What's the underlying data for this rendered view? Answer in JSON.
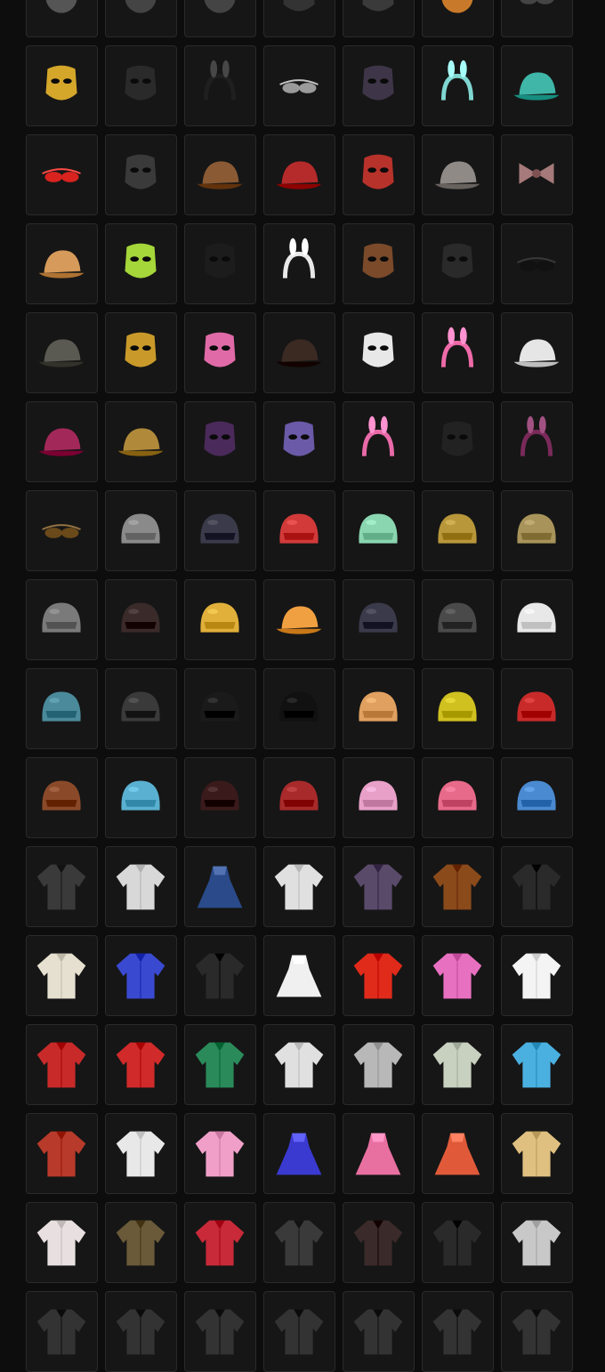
{
  "inventory": {
    "items": [
      {
        "icon": "headwear-icon",
        "color": "#555555"
      },
      {
        "icon": "headwear-icon",
        "color": "#444444"
      },
      {
        "icon": "headwear-icon",
        "color": "#444444"
      },
      {
        "icon": "mask-icon",
        "color": "#333333"
      },
      {
        "icon": "mask-icon",
        "color": "#3a3a3a"
      },
      {
        "icon": "headwear-icon",
        "color": "#c87a2a"
      },
      {
        "icon": "glasses-icon",
        "color": "#444444"
      },
      {
        "icon": "masquerade-mask-icon",
        "color": "#d4a62a"
      },
      {
        "icon": "mask-icon",
        "color": "#2a2a2a"
      },
      {
        "icon": "panda-headband-icon",
        "color": "#1f1f1f"
      },
      {
        "icon": "sunglasses-icon",
        "color": "#9a9a9a"
      },
      {
        "icon": "bandana-mask-icon",
        "color": "#3e3648"
      },
      {
        "icon": "bunny-headband-icon",
        "color": "#7fd6d0"
      },
      {
        "icon": "owl-hat-icon",
        "color": "#3fb6a8"
      },
      {
        "icon": "sunglasses-icon",
        "color": "#d8231f"
      },
      {
        "icon": "skull-mask-icon",
        "color": "#3a3a3a"
      },
      {
        "icon": "aviator-hat-icon",
        "color": "#8a5a34"
      },
      {
        "icon": "cap-icon",
        "color": "#b52a2a"
      },
      {
        "icon": "monster-mask-icon",
        "color": "#b7322b"
      },
      {
        "icon": "beanie-icon",
        "color": "#8f8a86"
      },
      {
        "icon": "bow-icon",
        "color": "#a67a7a"
      },
      {
        "icon": "ice-cream-hat-icon",
        "color": "#d69a5a"
      },
      {
        "icon": "ski-mask-icon",
        "color": "#a5d63a"
      },
      {
        "icon": "face-mask-icon",
        "color": "#1c1c1c"
      },
      {
        "icon": "headband-icon",
        "color": "#e8e8e8"
      },
      {
        "icon": "reindeer-mask-icon",
        "color": "#7a4a2a"
      },
      {
        "icon": "tactical-mask-icon",
        "color": "#2a2a2a"
      },
      {
        "icon": "sunglasses-icon",
        "color": "#111111"
      },
      {
        "icon": "cap-icon",
        "color": "#5a5a52"
      },
      {
        "icon": "dino-mask-icon",
        "color": "#c99a2a"
      },
      {
        "icon": "hippo-mask-icon",
        "color": "#e06aa8"
      },
      {
        "icon": "cowboy-hat-icon",
        "color": "#3a2a22"
      },
      {
        "icon": "face-mask-icon",
        "color": "#e8e8e8"
      },
      {
        "icon": "bow-headband-icon",
        "color": "#ee6aa8"
      },
      {
        "icon": "bear-beanie-icon",
        "color": "#e6e6e6"
      },
      {
        "icon": "beanie-icon",
        "color": "#a3285a"
      },
      {
        "icon": "bucket-hat-icon",
        "color": "#b08a3a"
      },
      {
        "icon": "mask-icon",
        "color": "#4a2a5a"
      },
      {
        "icon": "bunny-mask-icon",
        "color": "#6a5aa8"
      },
      {
        "icon": "bunny-headband-icon",
        "color": "#e86aa8"
      },
      {
        "icon": "eye-mask-icon",
        "color": "#222222"
      },
      {
        "icon": "headband-icon",
        "color": "#7a2a5a"
      },
      {
        "icon": "sunglasses-icon",
        "color": "#6a4a1a"
      },
      {
        "icon": "helmet-icon",
        "color": "#8a8a8a"
      },
      {
        "icon": "helmet-icon",
        "color": "#3a3a4a"
      },
      {
        "icon": "moto-helmet-icon",
        "color": "#d23a3a"
      },
      {
        "icon": "helmet-icon",
        "color": "#8ad6b0"
      },
      {
        "icon": "helmet-icon",
        "color": "#b8963a"
      },
      {
        "icon": "helmet-icon",
        "color": "#a8945a"
      },
      {
        "icon": "helmet-icon",
        "color": "#7a7a7a"
      },
      {
        "icon": "helmet-icon",
        "color": "#3a2a2a"
      },
      {
        "icon": "helmet-icon",
        "color": "#e0b03a"
      },
      {
        "icon": "cap-icon",
        "color": "#f0a040"
      },
      {
        "icon": "helmet-icon",
        "color": "#3a3a4a"
      },
      {
        "icon": "helmet-icon",
        "color": "#4a4a4a"
      },
      {
        "icon": "helmet-icon",
        "color": "#e8e8e8"
      },
      {
        "icon": "helmet-icon",
        "color": "#4a8a9a"
      },
      {
        "icon": "helmet-icon",
        "color": "#3a3a3a"
      },
      {
        "icon": "astronaut-helmet-icon",
        "color": "#1a1a1a"
      },
      {
        "icon": "moto-helmet-icon",
        "color": "#111111"
      },
      {
        "icon": "helmet-icon",
        "color": "#e0a060"
      },
      {
        "icon": "moto-helmet-icon",
        "color": "#d0c020"
      },
      {
        "icon": "helmet-icon",
        "color": "#c82a2a"
      },
      {
        "icon": "diving-helmet-icon",
        "color": "#8a4a2a"
      },
      {
        "icon": "helmet-icon",
        "color": "#5ab0d0"
      },
      {
        "icon": "helmet-icon",
        "color": "#3a1a1a"
      },
      {
        "icon": "helmet-icon",
        "color": "#a82a2a"
      },
      {
        "icon": "helmet-icon",
        "color": "#e8a0c8"
      },
      {
        "icon": "bunny-helmet-icon",
        "color": "#e86a8a"
      },
      {
        "icon": "helmet-icon",
        "color": "#4a8ad0"
      },
      {
        "icon": "shirt-icon",
        "color": "#3a3a3a"
      },
      {
        "icon": "jacket-icon",
        "color": "#d8d8d8"
      },
      {
        "icon": "dress-icon",
        "color": "#2a4a8a"
      },
      {
        "icon": "jacket-icon",
        "color": "#e0e0e0"
      },
      {
        "icon": "jacket-icon",
        "color": "#5a4a6a"
      },
      {
        "icon": "jacket-icon",
        "color": "#8a4a1a"
      },
      {
        "icon": "shirt-icon",
        "color": "#2a2a2a"
      },
      {
        "icon": "hoodie-icon",
        "color": "#e6e0d0"
      },
      {
        "icon": "jacket-icon",
        "color": "#3a4ad0"
      },
      {
        "icon": "jacket-icon",
        "color": "#2a2a2a"
      },
      {
        "icon": "dress-icon",
        "color": "#f0f0f0"
      },
      {
        "icon": "jacket-icon",
        "color": "#e02a1a"
      },
      {
        "icon": "top-icon",
        "color": "#e870c0"
      },
      {
        "icon": "shirt-icon",
        "color": "#f4f4f4"
      },
      {
        "icon": "shirt-icon",
        "color": "#c82a2a"
      },
      {
        "icon": "jacket-icon",
        "color": "#d02a2a"
      },
      {
        "icon": "coat-icon",
        "color": "#2a8a5a"
      },
      {
        "icon": "shirt-icon",
        "color": "#e0e0e0"
      },
      {
        "icon": "shirt-icon",
        "color": "#b8b8b8"
      },
      {
        "icon": "hoodie-icon",
        "color": "#c8d0c0"
      },
      {
        "icon": "top-icon",
        "color": "#4ab0e0"
      },
      {
        "icon": "shirt-icon",
        "color": "#b83a2a"
      },
      {
        "icon": "jacket-icon",
        "color": "#e8e8e8"
      },
      {
        "icon": "shirt-icon",
        "color": "#f0a0c8"
      },
      {
        "icon": "dress-icon",
        "color": "#3a3ad0"
      },
      {
        "icon": "dress-icon",
        "color": "#e870a0"
      },
      {
        "icon": "dress-icon",
        "color": "#e05a3a"
      },
      {
        "icon": "jacket-icon",
        "color": "#e0c080"
      },
      {
        "icon": "shirt-icon",
        "color": "#e8e0e0"
      },
      {
        "icon": "vest-icon",
        "color": "#6a5a3a"
      },
      {
        "icon": "top-icon",
        "color": "#c82a3a"
      },
      {
        "icon": "shirt-icon",
        "color": "#3a3a3a"
      },
      {
        "icon": "vest-icon",
        "color": "#3a2a2a"
      },
      {
        "icon": "hoodie-icon",
        "color": "#2a2a2a"
      },
      {
        "icon": "jacket-icon",
        "color": "#c8c8c8"
      },
      {
        "icon": "clothing-icon",
        "color": "#333333"
      },
      {
        "icon": "clothing-icon",
        "color": "#333333"
      },
      {
        "icon": "clothing-icon",
        "color": "#333333"
      },
      {
        "icon": "clothing-icon",
        "color": "#333333"
      },
      {
        "icon": "clothing-icon",
        "color": "#333333"
      },
      {
        "icon": "clothing-icon",
        "color": "#333333"
      },
      {
        "icon": "clothing-icon",
        "color": "#333333"
      }
    ]
  }
}
